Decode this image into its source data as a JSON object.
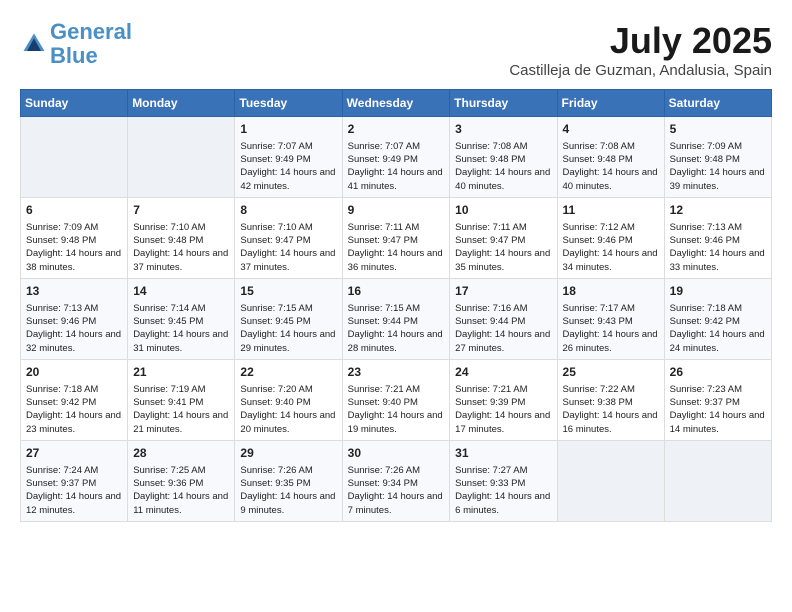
{
  "logo": {
    "line1": "General",
    "line2": "Blue"
  },
  "title": "July 2025",
  "subtitle": "Castilleja de Guzman, Andalusia, Spain",
  "headers": [
    "Sunday",
    "Monday",
    "Tuesday",
    "Wednesday",
    "Thursday",
    "Friday",
    "Saturday"
  ],
  "weeks": [
    [
      {
        "day": "",
        "empty": true
      },
      {
        "day": "",
        "empty": true
      },
      {
        "day": "1",
        "sunrise": "Sunrise: 7:07 AM",
        "sunset": "Sunset: 9:49 PM",
        "daylight": "Daylight: 14 hours and 42 minutes."
      },
      {
        "day": "2",
        "sunrise": "Sunrise: 7:07 AM",
        "sunset": "Sunset: 9:49 PM",
        "daylight": "Daylight: 14 hours and 41 minutes."
      },
      {
        "day": "3",
        "sunrise": "Sunrise: 7:08 AM",
        "sunset": "Sunset: 9:48 PM",
        "daylight": "Daylight: 14 hours and 40 minutes."
      },
      {
        "day": "4",
        "sunrise": "Sunrise: 7:08 AM",
        "sunset": "Sunset: 9:48 PM",
        "daylight": "Daylight: 14 hours and 40 minutes."
      },
      {
        "day": "5",
        "sunrise": "Sunrise: 7:09 AM",
        "sunset": "Sunset: 9:48 PM",
        "daylight": "Daylight: 14 hours and 39 minutes."
      }
    ],
    [
      {
        "day": "6",
        "sunrise": "Sunrise: 7:09 AM",
        "sunset": "Sunset: 9:48 PM",
        "daylight": "Daylight: 14 hours and 38 minutes."
      },
      {
        "day": "7",
        "sunrise": "Sunrise: 7:10 AM",
        "sunset": "Sunset: 9:48 PM",
        "daylight": "Daylight: 14 hours and 37 minutes."
      },
      {
        "day": "8",
        "sunrise": "Sunrise: 7:10 AM",
        "sunset": "Sunset: 9:47 PM",
        "daylight": "Daylight: 14 hours and 37 minutes."
      },
      {
        "day": "9",
        "sunrise": "Sunrise: 7:11 AM",
        "sunset": "Sunset: 9:47 PM",
        "daylight": "Daylight: 14 hours and 36 minutes."
      },
      {
        "day": "10",
        "sunrise": "Sunrise: 7:11 AM",
        "sunset": "Sunset: 9:47 PM",
        "daylight": "Daylight: 14 hours and 35 minutes."
      },
      {
        "day": "11",
        "sunrise": "Sunrise: 7:12 AM",
        "sunset": "Sunset: 9:46 PM",
        "daylight": "Daylight: 14 hours and 34 minutes."
      },
      {
        "day": "12",
        "sunrise": "Sunrise: 7:13 AM",
        "sunset": "Sunset: 9:46 PM",
        "daylight": "Daylight: 14 hours and 33 minutes."
      }
    ],
    [
      {
        "day": "13",
        "sunrise": "Sunrise: 7:13 AM",
        "sunset": "Sunset: 9:46 PM",
        "daylight": "Daylight: 14 hours and 32 minutes."
      },
      {
        "day": "14",
        "sunrise": "Sunrise: 7:14 AM",
        "sunset": "Sunset: 9:45 PM",
        "daylight": "Daylight: 14 hours and 31 minutes."
      },
      {
        "day": "15",
        "sunrise": "Sunrise: 7:15 AM",
        "sunset": "Sunset: 9:45 PM",
        "daylight": "Daylight: 14 hours and 29 minutes."
      },
      {
        "day": "16",
        "sunrise": "Sunrise: 7:15 AM",
        "sunset": "Sunset: 9:44 PM",
        "daylight": "Daylight: 14 hours and 28 minutes."
      },
      {
        "day": "17",
        "sunrise": "Sunrise: 7:16 AM",
        "sunset": "Sunset: 9:44 PM",
        "daylight": "Daylight: 14 hours and 27 minutes."
      },
      {
        "day": "18",
        "sunrise": "Sunrise: 7:17 AM",
        "sunset": "Sunset: 9:43 PM",
        "daylight": "Daylight: 14 hours and 26 minutes."
      },
      {
        "day": "19",
        "sunrise": "Sunrise: 7:18 AM",
        "sunset": "Sunset: 9:42 PM",
        "daylight": "Daylight: 14 hours and 24 minutes."
      }
    ],
    [
      {
        "day": "20",
        "sunrise": "Sunrise: 7:18 AM",
        "sunset": "Sunset: 9:42 PM",
        "daylight": "Daylight: 14 hours and 23 minutes."
      },
      {
        "day": "21",
        "sunrise": "Sunrise: 7:19 AM",
        "sunset": "Sunset: 9:41 PM",
        "daylight": "Daylight: 14 hours and 21 minutes."
      },
      {
        "day": "22",
        "sunrise": "Sunrise: 7:20 AM",
        "sunset": "Sunset: 9:40 PM",
        "daylight": "Daylight: 14 hours and 20 minutes."
      },
      {
        "day": "23",
        "sunrise": "Sunrise: 7:21 AM",
        "sunset": "Sunset: 9:40 PM",
        "daylight": "Daylight: 14 hours and 19 minutes."
      },
      {
        "day": "24",
        "sunrise": "Sunrise: 7:21 AM",
        "sunset": "Sunset: 9:39 PM",
        "daylight": "Daylight: 14 hours and 17 minutes."
      },
      {
        "day": "25",
        "sunrise": "Sunrise: 7:22 AM",
        "sunset": "Sunset: 9:38 PM",
        "daylight": "Daylight: 14 hours and 16 minutes."
      },
      {
        "day": "26",
        "sunrise": "Sunrise: 7:23 AM",
        "sunset": "Sunset: 9:37 PM",
        "daylight": "Daylight: 14 hours and 14 minutes."
      }
    ],
    [
      {
        "day": "27",
        "sunrise": "Sunrise: 7:24 AM",
        "sunset": "Sunset: 9:37 PM",
        "daylight": "Daylight: 14 hours and 12 minutes."
      },
      {
        "day": "28",
        "sunrise": "Sunrise: 7:25 AM",
        "sunset": "Sunset: 9:36 PM",
        "daylight": "Daylight: 14 hours and 11 minutes."
      },
      {
        "day": "29",
        "sunrise": "Sunrise: 7:26 AM",
        "sunset": "Sunset: 9:35 PM",
        "daylight": "Daylight: 14 hours and 9 minutes."
      },
      {
        "day": "30",
        "sunrise": "Sunrise: 7:26 AM",
        "sunset": "Sunset: 9:34 PM",
        "daylight": "Daylight: 14 hours and 7 minutes."
      },
      {
        "day": "31",
        "sunrise": "Sunrise: 7:27 AM",
        "sunset": "Sunset: 9:33 PM",
        "daylight": "Daylight: 14 hours and 6 minutes."
      },
      {
        "day": "",
        "empty": true
      },
      {
        "day": "",
        "empty": true
      }
    ]
  ]
}
